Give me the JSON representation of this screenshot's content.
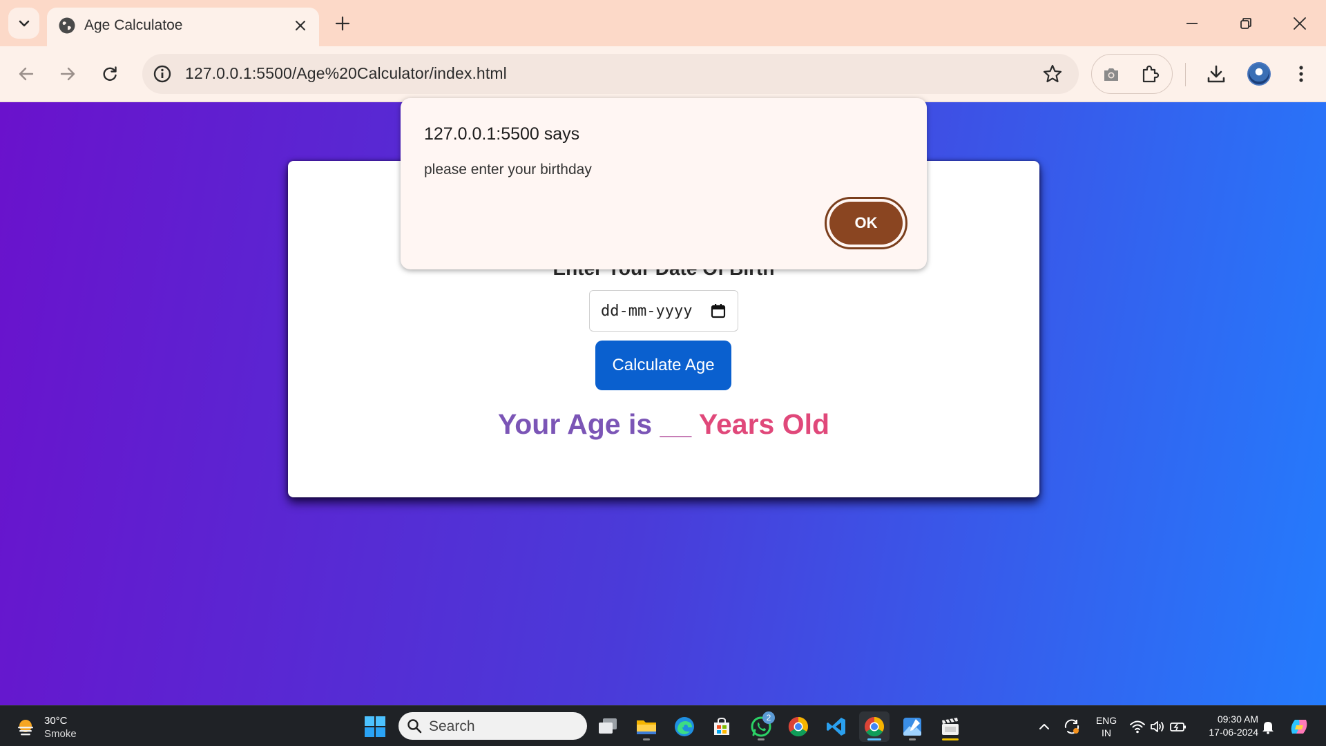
{
  "browser": {
    "tab_title": "Age Calculatoe",
    "url": "127.0.0.1:5500/Age%20Calculator/index.html"
  },
  "page": {
    "heading": "Enter Your Date Of Birth",
    "date_placeholder": "dd-mm-yyyy",
    "calculate_label": "Calculate Age",
    "result_prefix": "Your Age is",
    "result_blank": "__",
    "result_suffix": "Years Old"
  },
  "dialog": {
    "title": "127.0.0.1:5500 says",
    "message": "please enter your birthday",
    "ok_label": "OK"
  },
  "taskbar": {
    "weather_temp": "30°C",
    "weather_condition": "Smoke",
    "search_label": "Search",
    "whatsapp_badge": "2",
    "lang_line1": "ENG",
    "lang_line2": "IN",
    "time": "09:30 AM",
    "date": "17-06-2024"
  },
  "colors": {
    "gradient_start": "#6a12cc",
    "gradient_end": "#247cfd",
    "button_blue": "#0a60cf",
    "ok_brown": "#8a4521",
    "result_purple": "#7b55b6",
    "result_pink": "#e0487a"
  }
}
